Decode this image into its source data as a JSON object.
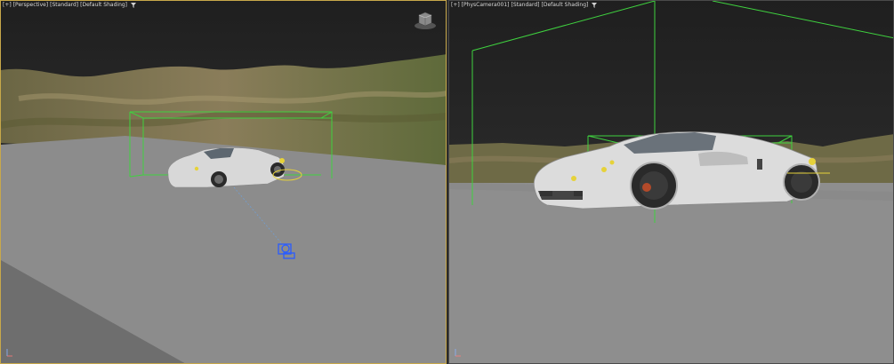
{
  "viewports": {
    "left": {
      "menu": "[+]",
      "view": "[Perspective]",
      "shading_mode": "[Standard]",
      "shading": "[Default Shading]",
      "filter_icon": "funnel-icon"
    },
    "right": {
      "menu": "[+]",
      "view": "[PhysCamera001]",
      "shading_mode": "[Standard]",
      "shading": "[Default Shading]",
      "filter_icon": "funnel-icon"
    }
  },
  "icons": {
    "viewcube": "viewcube-icon",
    "axis": "axis-tripod-icon",
    "camera": "camera-icon"
  },
  "colors": {
    "active_border": "#c8a84a",
    "sky": "#262626",
    "ground": "#8c8c8c",
    "bounds_green": "#3fd23f",
    "light_yellow": "#e6d23a",
    "camera_blue": "#2a5cff"
  }
}
